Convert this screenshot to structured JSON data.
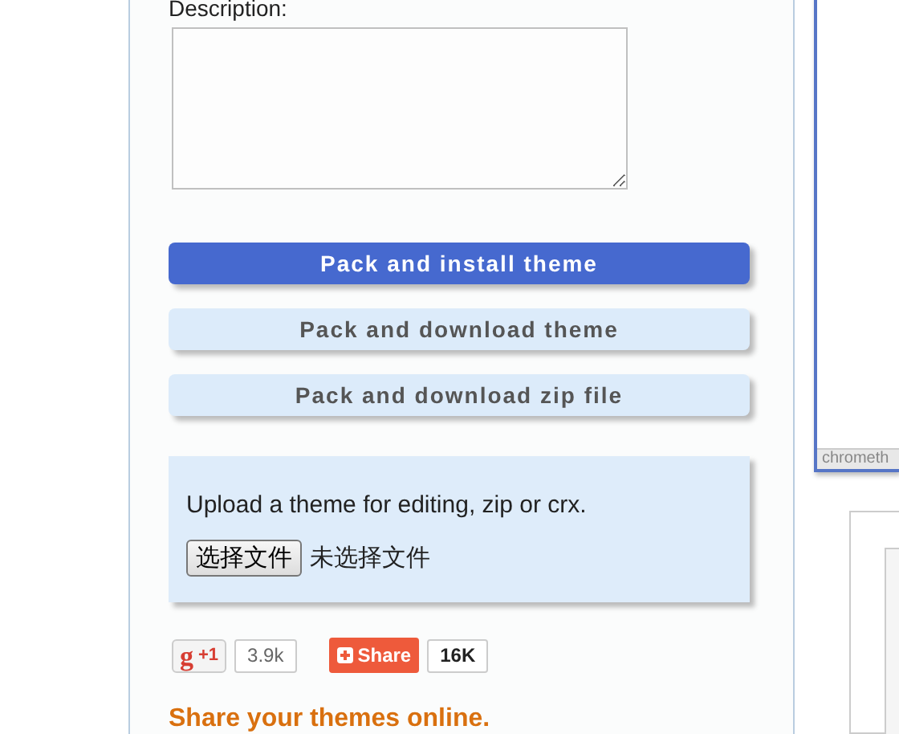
{
  "form": {
    "description_label": "Description:",
    "buttons": [
      {
        "label": "Pack and install theme",
        "primary": true
      },
      {
        "label": "Pack and download theme",
        "primary": false
      },
      {
        "label": "Pack and download zip file",
        "primary": false
      }
    ],
    "upload": {
      "text": "Upload a theme for editing, zip or crx.",
      "choose_button": "选择文件",
      "file_status": "未选择文件"
    },
    "social": {
      "plus_logo": "g",
      "plus_label": "+1",
      "plus_count": "3.9k",
      "share_label": "Share",
      "share_count": "16K"
    },
    "share_heading": "Share your themes online."
  },
  "preview": {
    "caption": "chrometh"
  }
}
